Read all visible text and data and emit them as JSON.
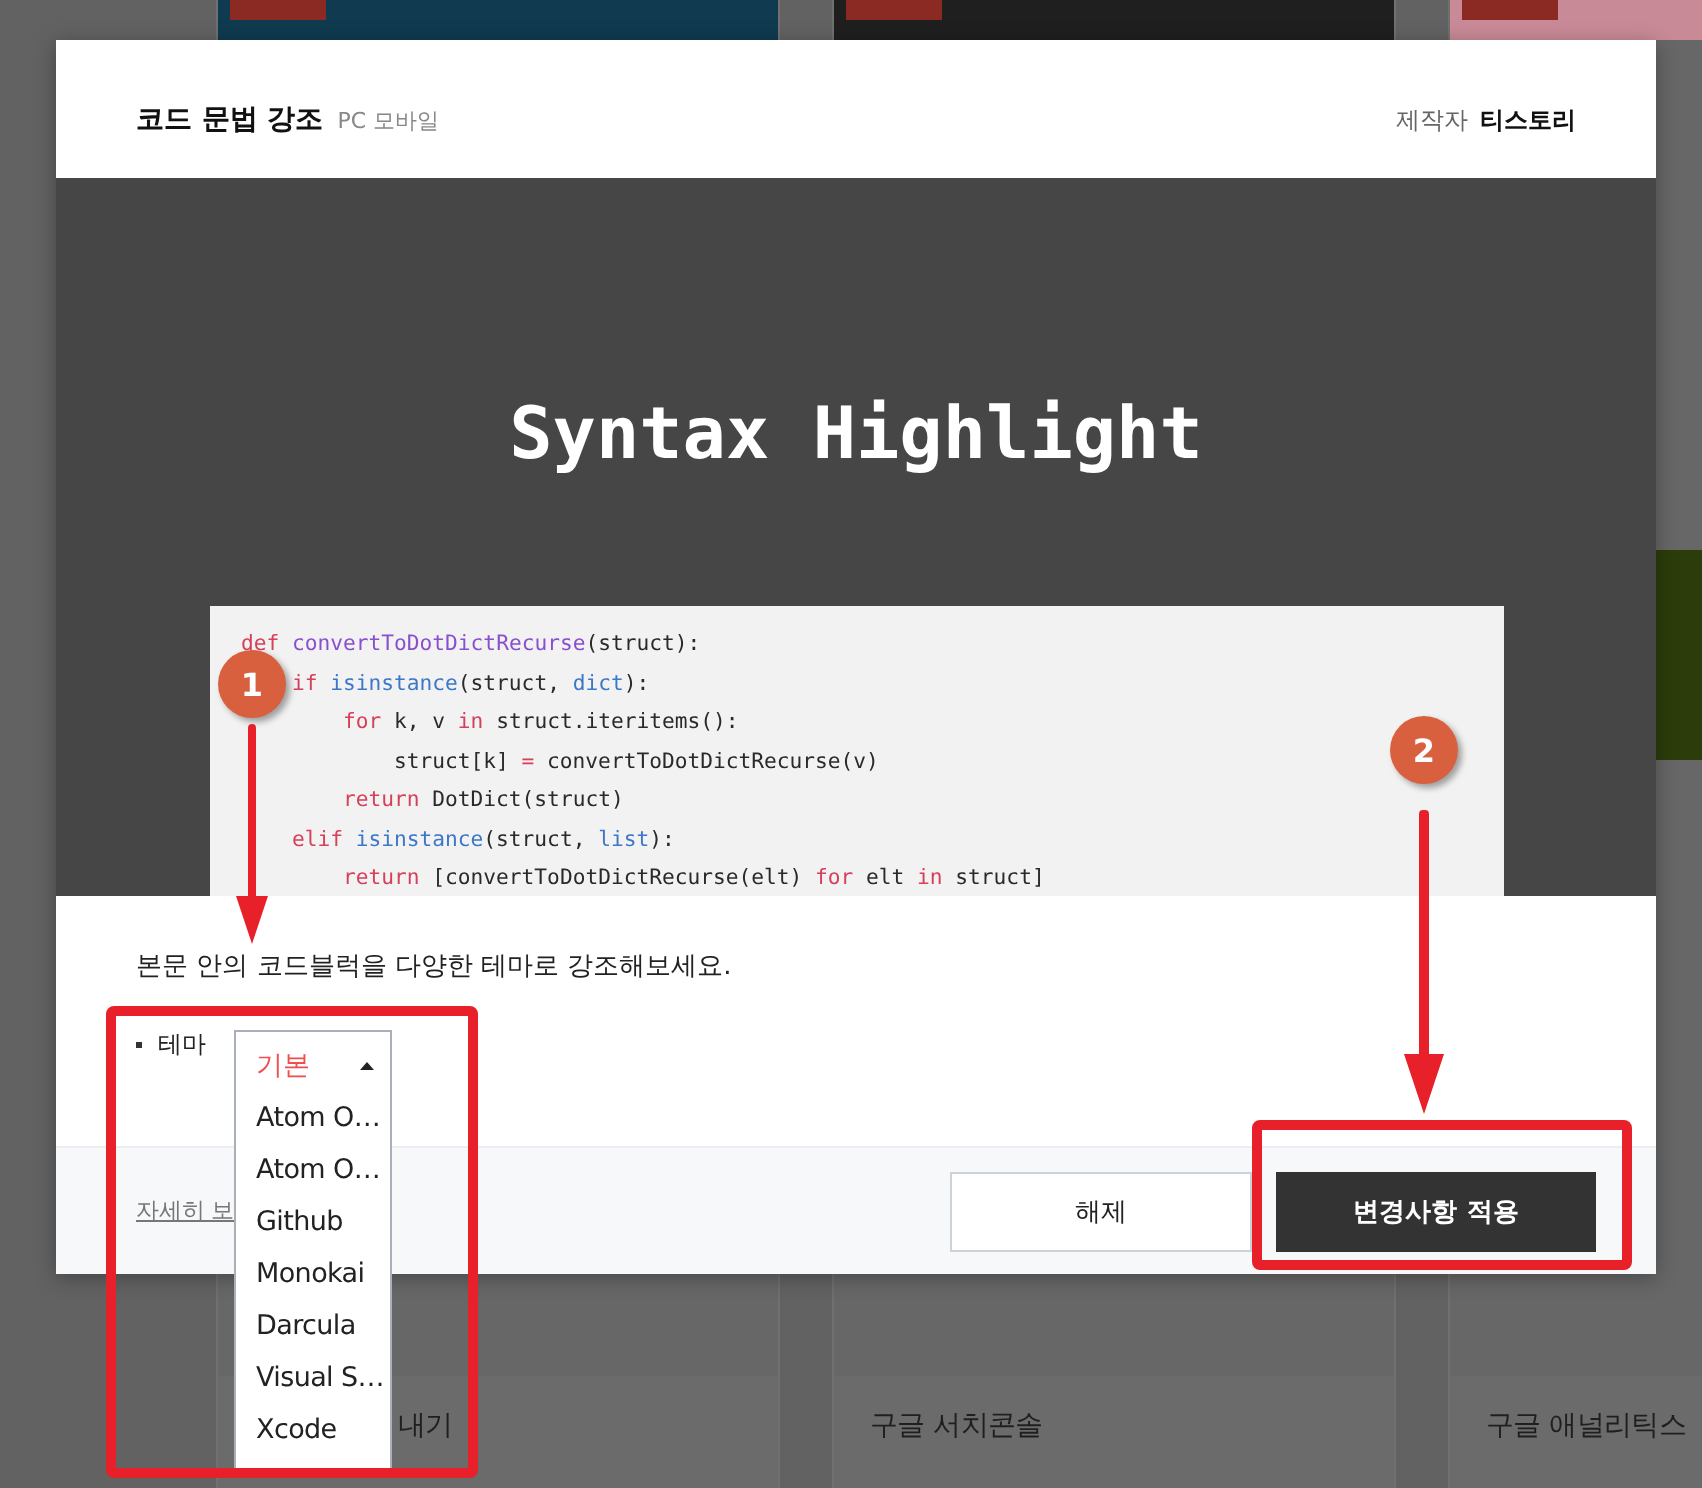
{
  "background": {
    "bottom_titles": [
      "내기",
      "구글 서치콘솔",
      "구글 애널리틱스"
    ]
  },
  "modal": {
    "title": "코드 문법 강조",
    "platforms": "PC 모바일",
    "maker_label": "제작자",
    "maker": "티스토리",
    "banner_title": "Syntax Highlight",
    "code_lines": [
      {
        "tokens": [
          {
            "kind": "kw",
            "text": "def "
          },
          {
            "kind": "fn",
            "text": "convertToDotDictRecurse"
          },
          {
            "kind": "plain",
            "text": "(struct):"
          }
        ],
        "children": [
          {
            "tokens": [
              {
                "kind": "kw",
                "text": "if "
              },
              {
                "kind": "builtin",
                "text": "isinstance"
              },
              {
                "kind": "plain",
                "text": "(struct, "
              },
              {
                "kind": "builtin",
                "text": "dict"
              },
              {
                "kind": "plain",
                "text": "):"
              }
            ],
            "children": [
              {
                "tokens": [
                  {
                    "kind": "kw",
                    "text": "for"
                  },
                  {
                    "kind": "plain",
                    "text": " k, v "
                  },
                  {
                    "kind": "kw",
                    "text": "in"
                  },
                  {
                    "kind": "plain",
                    "text": " struct.iteritems():"
                  }
                ],
                "children": [
                  {
                    "tokens": [
                      {
                        "kind": "plain",
                        "text": "struct[k] "
                      },
                      {
                        "kind": "kw",
                        "text": "="
                      },
                      {
                        "kind": "plain",
                        "text": " convertToDotDictRecurse(v)"
                      }
                    ]
                  }
                ]
              },
              {
                "tokens": [
                  {
                    "kind": "kw",
                    "text": "return"
                  },
                  {
                    "kind": "plain",
                    "text": " DotDict(struct)"
                  }
                ]
              }
            ]
          },
          {
            "tokens": [
              {
                "kind": "kw",
                "text": "elif "
              },
              {
                "kind": "builtin",
                "text": "isinstance"
              },
              {
                "kind": "plain",
                "text": "(struct, "
              },
              {
                "kind": "builtin",
                "text": "list"
              },
              {
                "kind": "plain",
                "text": "):"
              }
            ],
            "children": [
              {
                "tokens": [
                  {
                    "kind": "kw",
                    "text": "return"
                  },
                  {
                    "kind": "plain",
                    "text": " [convertToDotDictRecurse(elt) "
                  },
                  {
                    "kind": "kw",
                    "text": "for"
                  },
                  {
                    "kind": "plain",
                    "text": " elt "
                  },
                  {
                    "kind": "kw",
                    "text": "in"
                  },
                  {
                    "kind": "plain",
                    "text": " struct]"
                  }
                ]
              }
            ]
          }
        ]
      }
    ],
    "description": "본문 안의 코드블럭을 다양한 테마로 강조해보세요.",
    "theme_label": "테마",
    "theme_options": [
      {
        "label": "기본",
        "selected": true
      },
      {
        "label": "Atom O…",
        "selected": false
      },
      {
        "label": "Atom O…",
        "selected": false
      },
      {
        "label": "Github",
        "selected": false
      },
      {
        "label": "Monokai",
        "selected": false
      },
      {
        "label": "Darcula",
        "selected": false
      },
      {
        "label": "Visual S…",
        "selected": false
      },
      {
        "label": "Xcode",
        "selected": false
      }
    ],
    "more_link": "자세히 보",
    "buttons": [
      {
        "label": "해제",
        "kind": "secondary"
      },
      {
        "label": "변경사항 적용",
        "kind": "primary"
      }
    ]
  },
  "callouts": [
    {
      "number": "1"
    },
    {
      "number": "2"
    }
  ]
}
